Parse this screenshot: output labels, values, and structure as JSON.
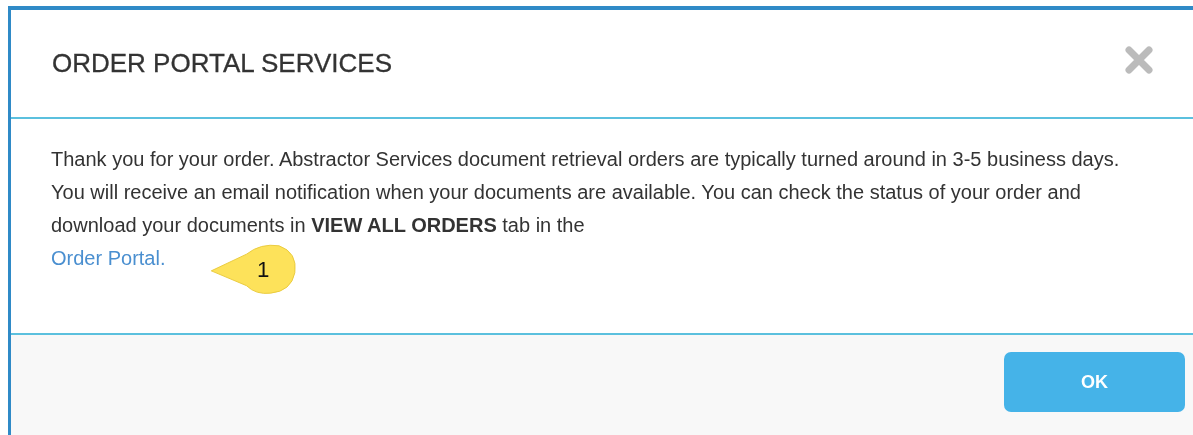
{
  "dialog": {
    "title": "ORDER PORTAL SERVICES",
    "message": "Thank you for your order. Abstractor Services document retrieval orders are typically turned around in 3-5 business days. You will receive an email notification when your documents are available. You can check the status of your order and download your documents in **VIEW ALL ORDERS** tab in the",
    "link": "Order Portal.",
    "callout": "1",
    "buttons": [
      "OK"
    ]
  }
}
